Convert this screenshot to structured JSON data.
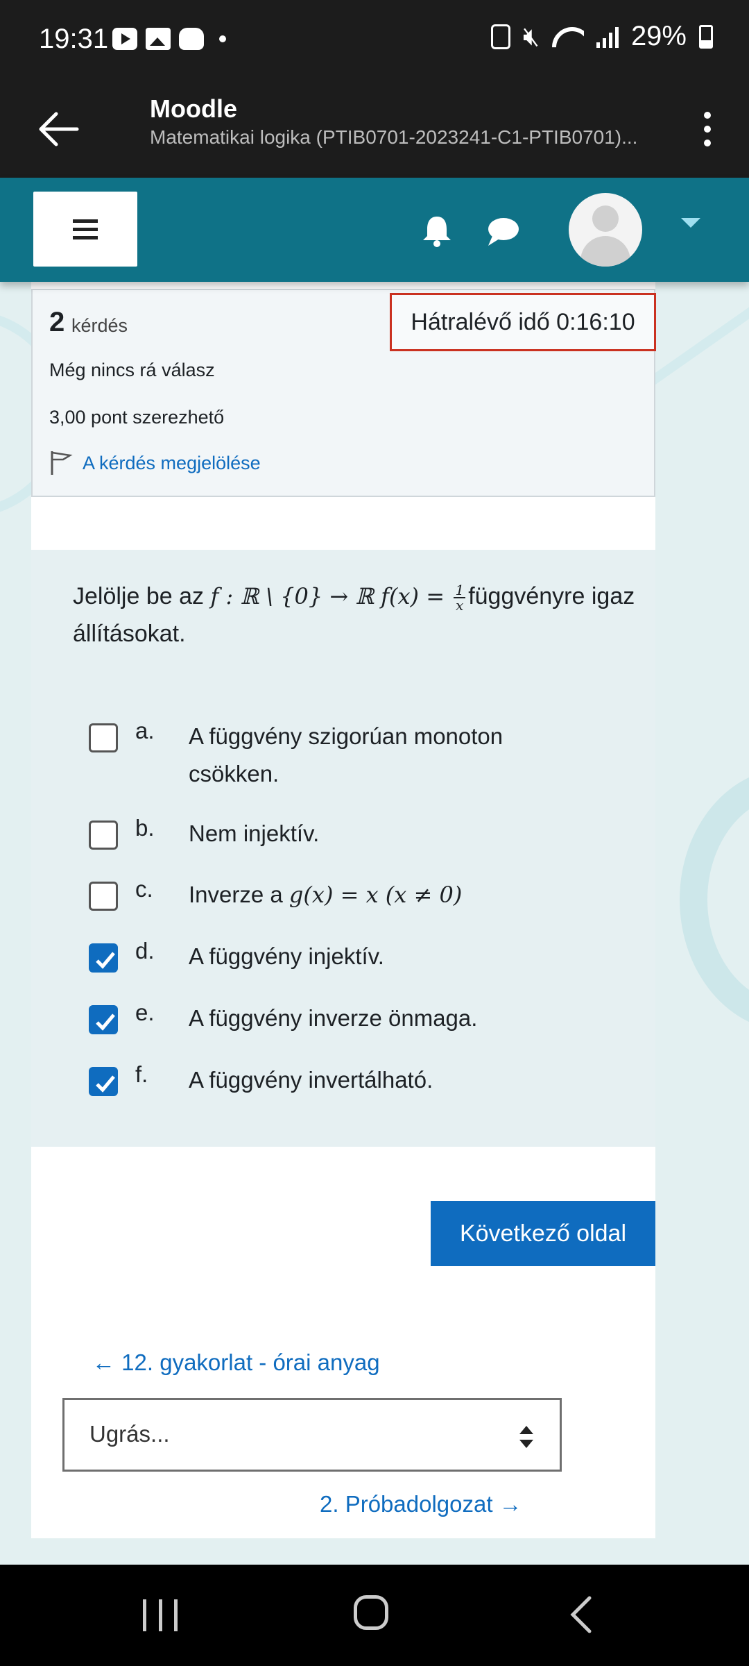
{
  "status_bar": {
    "time": "19:31",
    "battery": "29%",
    "left_icons": [
      "youtube-icon",
      "gallery-icon",
      "discord-icon",
      "dot-icon"
    ],
    "right_icons": [
      "battery-saver-icon",
      "mute-icon",
      "wifi-icon",
      "signal-icon",
      "battery-icon"
    ]
  },
  "app_bar": {
    "title": "Moodle",
    "subtitle": "Matematikai logika (PTIB0701-2023241-C1-PTIB0701)..."
  },
  "question_info": {
    "number": "2",
    "number_word": "kérdés",
    "status": "Még nincs rá válasz",
    "points": "3,00 pont szerezhető",
    "flag_label": "A kérdés megjelölése",
    "timer": "Hátralévő idő 0:16:10"
  },
  "question": {
    "text_before": "Jelölje be az ",
    "math_expr": "f : ℝ \\ {0} → ℝ f(x) =",
    "frac_num": "1",
    "frac_den": "x",
    "text_after": "függvényre igaz állításokat.",
    "answers": [
      {
        "letter": "a.",
        "text": "A függvény szigorúan monoton csökken.",
        "checked": false
      },
      {
        "letter": "b.",
        "text": "Nem injektív.",
        "checked": false
      },
      {
        "letter": "c.",
        "text_prefix": "Inverze a ",
        "math": "g(x) = x (x ≠ 0)",
        "checked": false
      },
      {
        "letter": "d.",
        "text": "A függvény injektív.",
        "checked": true
      },
      {
        "letter": "e.",
        "text": "A függvény inverze önmaga.",
        "checked": true
      },
      {
        "letter": "f.",
        "text": "A függvény invertálható.",
        "checked": true
      }
    ]
  },
  "navigation": {
    "next_button": "Következő oldal",
    "prev_link": "← 12. gyakorlat - órai  anyag",
    "jump_select": "Ugrás...",
    "next_link": "2. Próbadolgozat →"
  },
  "colors": {
    "header_teal": "#0f7287",
    "link_blue": "#0f6cbf",
    "timer_border": "#ca3120"
  }
}
